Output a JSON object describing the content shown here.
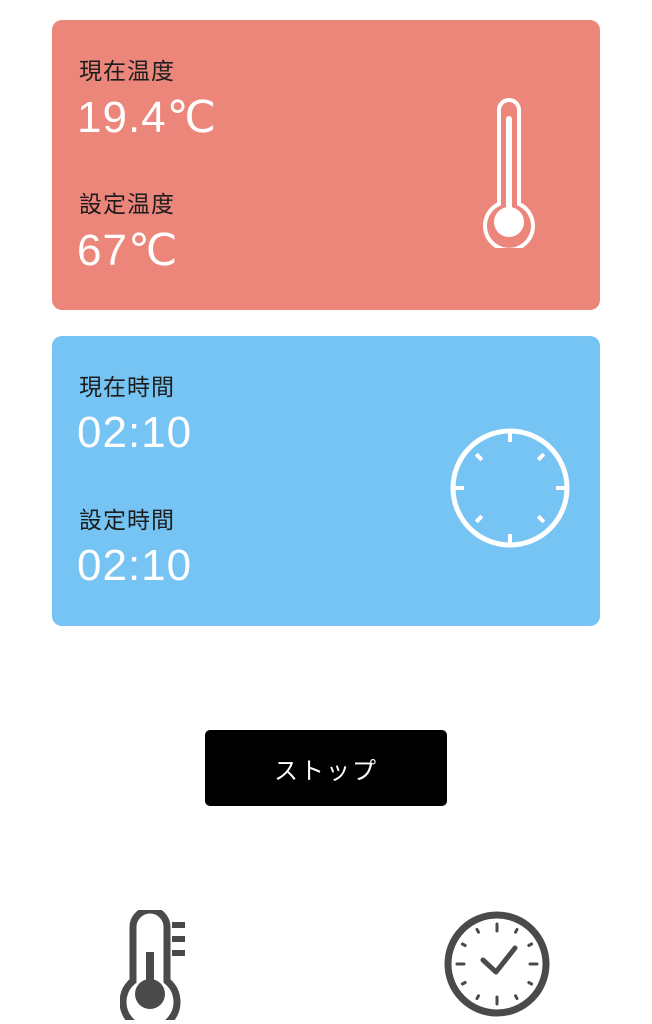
{
  "temperature_card": {
    "current_label": "現在温度",
    "current_value": "19.4℃",
    "set_label": "設定温度",
    "set_value": "67℃",
    "icon": "thermometer-icon",
    "color": "#ec867a"
  },
  "time_card": {
    "current_label": "現在時間",
    "current_value": "02:10",
    "set_label": "設定時間",
    "set_value": "02:10",
    "icon": "clock-icon",
    "color": "#76c4f3"
  },
  "stop_button": {
    "label": "ストップ"
  },
  "bottom_nav": {
    "items": [
      {
        "icon": "thermometer-icon"
      },
      {
        "icon": "clock-icon"
      }
    ]
  }
}
